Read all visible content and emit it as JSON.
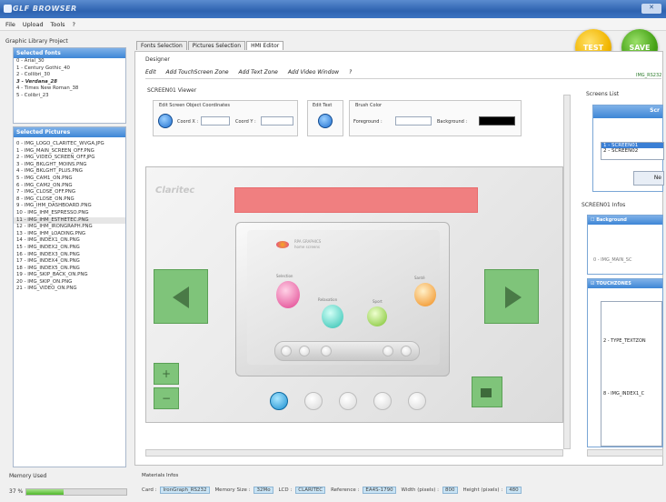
{
  "window": {
    "title": "GLF BROWSER"
  },
  "menu": {
    "items": [
      "File",
      "Upload",
      "Tools",
      "?"
    ]
  },
  "actions": {
    "test_label": "TEST",
    "save_label": "SAVE"
  },
  "left": {
    "project_label": "Graphic Library Project",
    "fonts_header": "Selected fonts",
    "fonts": [
      "0 - Arial_30",
      "1 - Century Gothic_40",
      "2 - Collibri_30",
      "3 - Verdana_28",
      "4 - Times New Roman_38",
      "5 - Colibri_23"
    ],
    "pictures_header": "Selected Pictures",
    "pictures": [
      "0 - IMG_LOGO_CLARITEC_WVGA.JPG",
      "1 - IMG_MAIN_SCREEN_OFF.PNG",
      "2 - IMG_VIDEO_SCREEN_OFF.JPG",
      "3 - IMG_BKLGHT_MOINS.PNG",
      "4 - IMG_BKLGHT_PLUS.PNG",
      "5 - IMG_CAM1_ON.PNG",
      "6 - IMG_CAM2_ON.PNG",
      "7 - IMG_CLOSE_OFF.PNG",
      "8 - IMG_CLOSE_ON.PNG",
      "9 - IMG_IHM_DASHBOARD.PNG",
      "10 - IMG_IHM_ESPRESSO.PNG",
      "11 - IMG_IHM_ESTHETEC.PNG",
      "12 - IMG_IHM_IRONGRAPH.PNG",
      "13 - IMG_IHM_LOADING.PNG",
      "14 - IMG_INDEX1_ON.PNG",
      "15 - IMG_INDEX2_ON.PNG",
      "16 - IMG_INDEX3_ON.PNG",
      "17 - IMG_INDEX4_ON.PNG",
      "18 - IMG_INDEX5_ON.PNG",
      "19 - IMG_SKIP_BACK_ON.PNG",
      "20 - IMG_SKIP_ON.PNG",
      "21 - IMG_VIDEO_ON.PNG"
    ],
    "memory_label": "Memory Used",
    "memory_percent": "37 %",
    "memory_fraction": 0.37
  },
  "tabs": [
    {
      "label": "Fonts Selection",
      "active": false
    },
    {
      "label": "Pictures Selection",
      "active": false
    },
    {
      "label": "HMI Editor",
      "active": true
    }
  ],
  "designer": {
    "label": "Designer",
    "toolbar": [
      "Edit",
      "Add TouchScreen Zone",
      "Add Text Zone",
      "Add Video Window",
      "?"
    ],
    "right_tag": "IMG_RS232"
  },
  "viewer": {
    "label": "SCREEN01 Viewer",
    "coord_group": "Edit Screen Object Coordinates",
    "coord_x": "Coord X :",
    "coord_y": "Coord Y :",
    "edit_text": "Edit Text",
    "brush_group": "Brush Color",
    "foreground": "Foreground :",
    "background": "Background :",
    "brand": "Claritec",
    "device_title_1": "RPA GRAPHICS",
    "device_title_2": "home screens",
    "tiles": [
      "Selection",
      "Relaxation",
      "Sport",
      "Santé"
    ]
  },
  "screens": {
    "label": "Screens List",
    "header": "Scr",
    "items": [
      "1 - SCREEN01",
      "2 - SCREEN02"
    ],
    "new_button": "Ne"
  },
  "infos": {
    "label": "SCREEN01 Infos",
    "background_check": "Background",
    "background_value": "0 - IMG_MAIN_SC",
    "touch_check": "TOUCHZONES",
    "entries": [
      "2 - TYPE_TEXTZON",
      "8 - IMG_INDEX1_C"
    ]
  },
  "materials": {
    "label": "Materials Infos",
    "card_label": "Card :",
    "card": "IronGraph_RS232",
    "memsize_label": "Memory Size :",
    "memsize": "32Mo",
    "lcd_label": "LCD :",
    "lcd": "CLARITEC",
    "ref_label": "Reference :",
    "ref": "EA4S-1790",
    "width_label": "Width (pixels) :",
    "width": "800",
    "height_label": "Height (pixels) :",
    "height": "480"
  },
  "colors": {
    "title_blue": "#2e63b0",
    "header_blue": "#3d86d6",
    "test_yellow": "#f2b600",
    "save_green": "#46a316",
    "nav_green": "#7fc47a",
    "banner_red": "#f07f80"
  }
}
